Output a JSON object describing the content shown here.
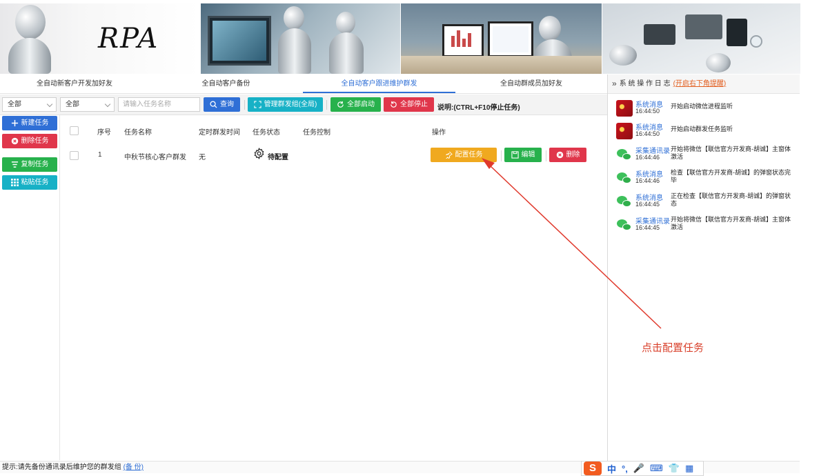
{
  "banner": {
    "logo_text": "RPA"
  },
  "tabs": [
    {
      "label": "全自动新客户开发加好友"
    },
    {
      "label": "全自动客户备份"
    },
    {
      "label": "全自动客户跟进维护群发"
    },
    {
      "label": "全自动群成员加好友"
    }
  ],
  "active_tab": 2,
  "toolbar": {
    "select1_value": "全部",
    "select2_value": "全部",
    "search_placeholder": "请输入任务名称",
    "query_label": "查询",
    "manage_group_label": "管理群发组(全局)",
    "start_all_label": "全部启动",
    "stop_all_label": "全部停止",
    "hint": "说明:(CTRL+F10停止任务)"
  },
  "left_actions": {
    "new_task": "新建任务",
    "delete_task": "删除任务",
    "copy_task": "复制任务",
    "paste_task": "粘贴任务"
  },
  "table": {
    "headers": {
      "index": "序号",
      "name": "任务名称",
      "schedule": "定时群发时间",
      "status": "任务状态",
      "control": "任务控制",
      "operation": "操作"
    },
    "rows": [
      {
        "index": "1",
        "name": "中秋节核心客户群发",
        "schedule": "无",
        "status": "待配置",
        "config_label": "配置任务",
        "edit_label": "编辑",
        "delete_label": "删除"
      }
    ]
  },
  "log_panel": {
    "title": "系 统 操 作 日 志",
    "link": "(开启右下角提醒)",
    "items": [
      {
        "source": "系统消息",
        "time": "16:44:50",
        "message": "开始启动微信进程监听",
        "avatar": "flag-avatar"
      },
      {
        "source": "系统消息",
        "time": "16:44:50",
        "message": "开始启动群发任务监听",
        "avatar": "flag-avatar"
      },
      {
        "source": "采集通讯录",
        "time": "16:44:46",
        "message": "开始将微信【联信官方开发商-胡诚】主窗体激活",
        "avatar": "wechat-icon"
      },
      {
        "source": "系统消息",
        "time": "16:44:46",
        "message": "检查【联信官方开发商-胡诚】的弹窗状态完毕",
        "avatar": "wechat-icon"
      },
      {
        "source": "系统消息",
        "time": "16:44:45",
        "message": "正在检查【联信官方开发商-胡诚】的弹窗状态",
        "avatar": "wechat-icon"
      },
      {
        "source": "采集通讯录",
        "time": "16:44:45",
        "message": "开始将微信【联信官方开发商-胡诚】主窗体激活",
        "avatar": "wechat-icon"
      }
    ]
  },
  "annotation": "点击配置任务",
  "status_bar": {
    "text": "提示:请先备份通讯录后维护您的群发组",
    "link": "(备 份)"
  },
  "ime": {
    "logo": "S",
    "items": [
      "中",
      "°,",
      "🎤",
      "⌨",
      "👕",
      "▦"
    ]
  },
  "colors": {
    "primary": "#2f6fd6",
    "cyan": "#17b1c6",
    "green": "#27b14c",
    "red": "#e0364b",
    "orange": "#f0a91f",
    "annotation": "#d9412c"
  }
}
